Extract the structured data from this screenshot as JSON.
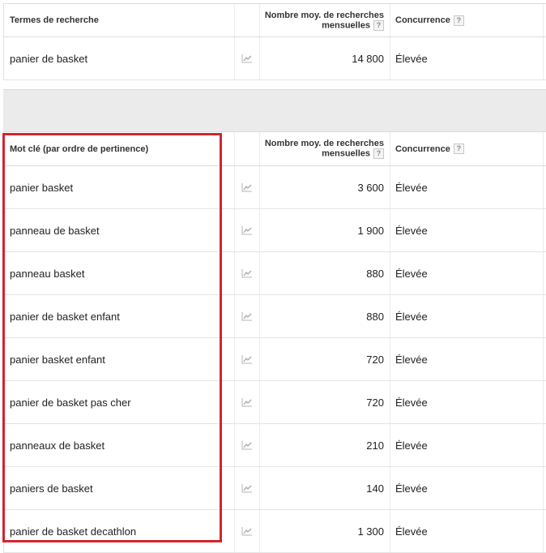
{
  "search_table": {
    "headers": {
      "keyword": "Termes de recherche",
      "volume_line1": "Nombre moy. de recherches",
      "volume_line2": "mensuelles",
      "competition": "Concurrence",
      "help": "?"
    },
    "rows": [
      {
        "keyword": "panier de basket",
        "volume": "14 800",
        "competition": "Élevée"
      }
    ]
  },
  "keyword_table": {
    "headers": {
      "keyword": "Mot clé (par ordre de pertinence)",
      "volume_line1": "Nombre moy. de recherches",
      "volume_line2": "mensuelles",
      "competition": "Concurrence",
      "help": "?"
    },
    "rows": [
      {
        "keyword": "panier basket",
        "volume": "3 600",
        "competition": "Élevée"
      },
      {
        "keyword": "panneau de basket",
        "volume": "1 900",
        "competition": "Élevée"
      },
      {
        "keyword": "panneau basket",
        "volume": "880",
        "competition": "Élevée"
      },
      {
        "keyword": "panier de basket enfant",
        "volume": "880",
        "competition": "Élevée"
      },
      {
        "keyword": "panier basket enfant",
        "volume": "720",
        "competition": "Élevée"
      },
      {
        "keyword": "panier de basket pas cher",
        "volume": "720",
        "competition": "Élevée"
      },
      {
        "keyword": "panneaux de basket",
        "volume": "210",
        "competition": "Élevée"
      },
      {
        "keyword": "paniers de basket",
        "volume": "140",
        "competition": "Élevée"
      },
      {
        "keyword": "panier de basket decathlon",
        "volume": "1 300",
        "competition": "Élevée"
      }
    ]
  },
  "icons": {
    "trend": "trend-chart-icon",
    "help": "help-question-icon"
  },
  "colors": {
    "highlight": "#d1252c",
    "separator": "#ebebeb"
  }
}
